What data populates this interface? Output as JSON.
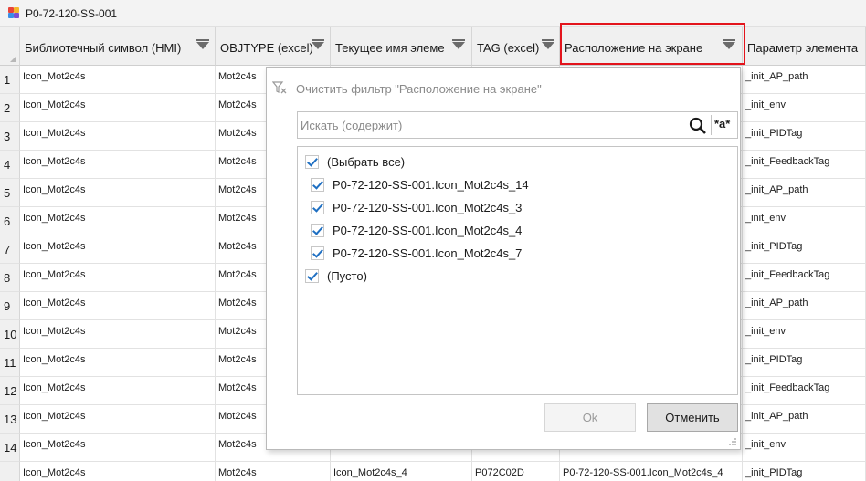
{
  "window": {
    "title": "P0-72-120-SS-001"
  },
  "grid": {
    "columns": [
      {
        "label": "Библиотечный символ (HMI)"
      },
      {
        "label": "OBJTYPE (excel)"
      },
      {
        "label": "Текущее имя элеме"
      },
      {
        "label": "TAG (excel)"
      },
      {
        "label": "Расположение на экране"
      },
      {
        "label": "Параметр элемента"
      }
    ],
    "rows": [
      {
        "n": "1",
        "c1": "Icon_Mot2c4s",
        "c2": "Mot2c4s",
        "c3": "",
        "c4": "",
        "c5": "",
        "c6": "_init_AP_path"
      },
      {
        "n": "2",
        "c1": "Icon_Mot2c4s",
        "c2": "Mot2c4s",
        "c3": "",
        "c4": "",
        "c5": "",
        "c6": "_init_env"
      },
      {
        "n": "3",
        "c1": "Icon_Mot2c4s",
        "c2": "Mot2c4s",
        "c3": "",
        "c4": "",
        "c5": "",
        "c6": "_init_PIDTag"
      },
      {
        "n": "4",
        "c1": "Icon_Mot2c4s",
        "c2": "Mot2c4s",
        "c3": "",
        "c4": "",
        "c5": "",
        "c6": "_init_FeedbackTag"
      },
      {
        "n": "5",
        "c1": "Icon_Mot2c4s",
        "c2": "Mot2c4s",
        "c3": "",
        "c4": "",
        "c5": "",
        "c6": "_init_AP_path"
      },
      {
        "n": "6",
        "c1": "Icon_Mot2c4s",
        "c2": "Mot2c4s",
        "c3": "",
        "c4": "",
        "c5": "",
        "c6": "_init_env"
      },
      {
        "n": "7",
        "c1": "Icon_Mot2c4s",
        "c2": "Mot2c4s",
        "c3": "",
        "c4": "",
        "c5": "",
        "c6": "_init_PIDTag"
      },
      {
        "n": "8",
        "c1": "Icon_Mot2c4s",
        "c2": "Mot2c4s",
        "c3": "",
        "c4": "",
        "c5": "",
        "c6": "_init_FeedbackTag"
      },
      {
        "n": "9",
        "c1": "Icon_Mot2c4s",
        "c2": "Mot2c4s",
        "c3": "",
        "c4": "",
        "c5": "",
        "c6": "_init_AP_path"
      },
      {
        "n": "10",
        "c1": "Icon_Mot2c4s",
        "c2": "Mot2c4s",
        "c3": "",
        "c4": "",
        "c5": "",
        "c6": "_init_env"
      },
      {
        "n": "11",
        "c1": "Icon_Mot2c4s",
        "c2": "Mot2c4s",
        "c3": "",
        "c4": "",
        "c5": "",
        "c6": "_init_PIDTag"
      },
      {
        "n": "12",
        "c1": "Icon_Mot2c4s",
        "c2": "Mot2c4s",
        "c3": "",
        "c4": "",
        "c5": "",
        "c6": "_init_FeedbackTag"
      },
      {
        "n": "13",
        "c1": "Icon_Mot2c4s",
        "c2": "Mot2c4s",
        "c3": "",
        "c4": "",
        "c5": "",
        "c6": "_init_AP_path"
      },
      {
        "n": "14",
        "c1": "Icon_Mot2c4s",
        "c2": "Mot2c4s",
        "c3": "",
        "c4": "",
        "c5": "",
        "c6": "_init_env"
      },
      {
        "n": "",
        "c1": "Icon_Mot2c4s",
        "c2": "Mot2c4s",
        "c3": "Icon_Mot2c4s_4",
        "c4": "P072C02D",
        "c5": "P0-72-120-SS-001.Icon_Mot2c4s_4",
        "c6": "_init_PIDTag"
      }
    ]
  },
  "filter_popup": {
    "clear_label": "Очистить фильтр \"Расположение на экране\"",
    "search_placeholder": "Искать (содержит)",
    "case_toggle": "*a*",
    "items": [
      {
        "label": "(Выбрать все)",
        "checked": true
      },
      {
        "label": "P0-72-120-SS-001.Icon_Mot2c4s_14",
        "checked": true
      },
      {
        "label": "P0-72-120-SS-001.Icon_Mot2c4s_3",
        "checked": true
      },
      {
        "label": "P0-72-120-SS-001.Icon_Mot2c4s_4",
        "checked": true
      },
      {
        "label": "P0-72-120-SS-001.Icon_Mot2c4s_7",
        "checked": true
      },
      {
        "label": "(Пусто)",
        "checked": true
      }
    ],
    "ok_label": "Ok",
    "cancel_label": "Отменить"
  },
  "colors": {
    "highlight": "#e3141c",
    "checkmark": "#1e6fc2"
  },
  "icons": [
    "app-icon",
    "filter-clear-icon",
    "search-icon",
    "resize-grip-icon",
    "filter-dropdown-icon"
  ]
}
